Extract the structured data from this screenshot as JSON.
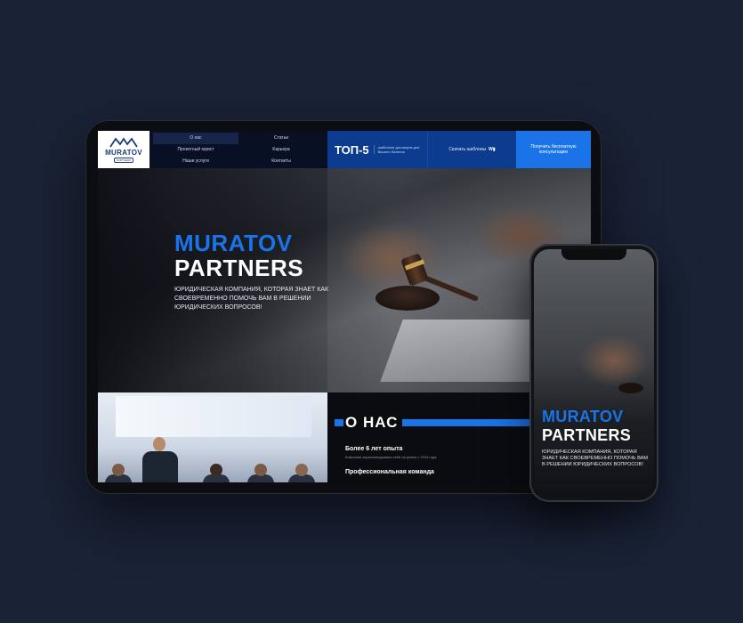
{
  "background_color": "#1a2236",
  "accent_color": "#1a74e8",
  "tablet": {
    "logo": {
      "name": "MURATOV",
      "tagline": "PARTNERS"
    },
    "nav": {
      "items": [
        "О нас",
        "Статьи",
        "Проектный юрист",
        "Карьера",
        "Наши услуги",
        "Контакты"
      ],
      "top5_title": "ТОП-5",
      "top5_desc": "шаблонов договоров для Вашего бизнеса",
      "download_label": "Скачать шаблоны",
      "download_icon": "word-icon",
      "consult_label": "Получить бесплатную консультацию"
    },
    "hero": {
      "title_line1": "MURATOV",
      "title_line2": "PARTNERS",
      "subtitle": "Юридическая компания, которая знает как своевременно помочь вам в решении юридических вопросов!"
    },
    "about": {
      "title": "О НАС",
      "item1_title": "Более 6 лет опыта",
      "item1_desc": "Компания зарекомендовала себя на рынке с 2014 года",
      "item2_title": "Профессиональная команда"
    }
  },
  "phone": {
    "title_line1": "MURATOV",
    "title_line2": "PARTNERS",
    "subtitle": "Юридическая компания, которая знает как своевременно помочь вам в решении юридических вопросов!"
  }
}
